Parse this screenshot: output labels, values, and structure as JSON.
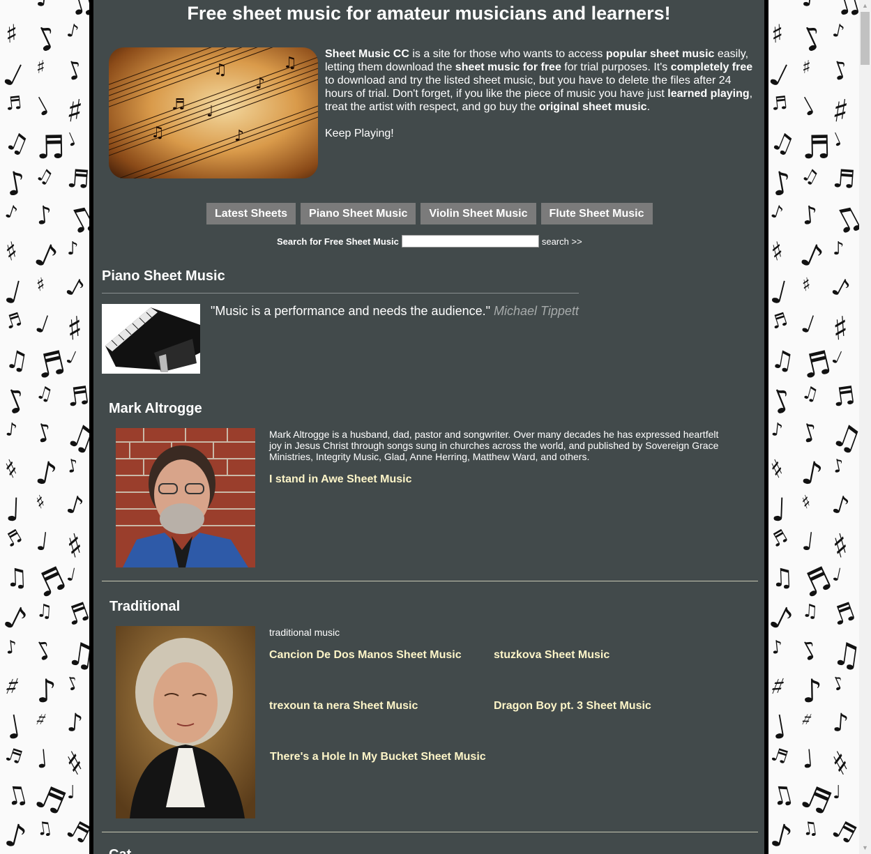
{
  "header": {
    "title": "Free sheet music for amateur musicians and learners!"
  },
  "intro": {
    "p1_parts": [
      {
        "text": "Sheet Music CC",
        "bold": true
      },
      {
        "text": " is a site for those who wants to access ",
        "bold": false
      },
      {
        "text": "popular sheet music",
        "bold": true
      },
      {
        "text": " easily, letting them download the ",
        "bold": false
      },
      {
        "text": "sheet music for free",
        "bold": true
      },
      {
        "text": " for trial purposes. It's ",
        "bold": false
      },
      {
        "text": "completely free",
        "bold": true
      },
      {
        "text": " to download and try the listed sheet music, but you have to delete the files after 24 hours of trial. Don't forget, if you like the piece of music you have just ",
        "bold": false
      },
      {
        "text": "learned playing",
        "bold": true
      },
      {
        "text": ", treat the artist with respect, and go buy the ",
        "bold": false
      },
      {
        "text": "original sheet music",
        "bold": true
      },
      {
        "text": ".",
        "bold": false
      }
    ],
    "p2": "Keep Playing!"
  },
  "nav": {
    "items": [
      "Latest Sheets",
      "Piano Sheet Music",
      "Violin Sheet Music",
      "Flute Sheet Music"
    ]
  },
  "search": {
    "label": "Search for Free Sheet Music",
    "value": "",
    "button": "search >>"
  },
  "category": {
    "title": "Piano Sheet Music",
    "quote": "\"Music is a performance and needs the audience.\"",
    "quote_author": "Michael Tippett"
  },
  "artists": [
    {
      "name": "Mark Altrogge",
      "description": "Mark Altrogge is a husband, dad, pastor and songwriter. Over many decades he has expressed heartfelt joy in Jesus Christ through songs sung in churches across the world, and published by Sovereign Grace Ministries, Integrity Music, Glad, Anne Herring, Matthew Ward, and others.",
      "links": [
        "I stand in Awe Sheet Music"
      ]
    },
    {
      "name": "Traditional",
      "description": "traditional music",
      "links": [
        "Cancion De Dos Manos Sheet Music",
        "stuzkova Sheet Music",
        "trexoun ta nera Sheet Music",
        "Dragon Boy pt. 3 Sheet Music",
        "There's a Hole In My Bucket Sheet Music"
      ]
    }
  ],
  "next_section_partial": "Cat",
  "colors": {
    "page_bg": "#424a4b",
    "link": "#fdf5c8",
    "nav_button": "#7b7b7b",
    "quote_author": "#a7abab"
  },
  "icons": {
    "background": "music-notes-pattern",
    "scroll_up": "chevron-up-icon",
    "scroll_down": "chevron-down-icon"
  }
}
